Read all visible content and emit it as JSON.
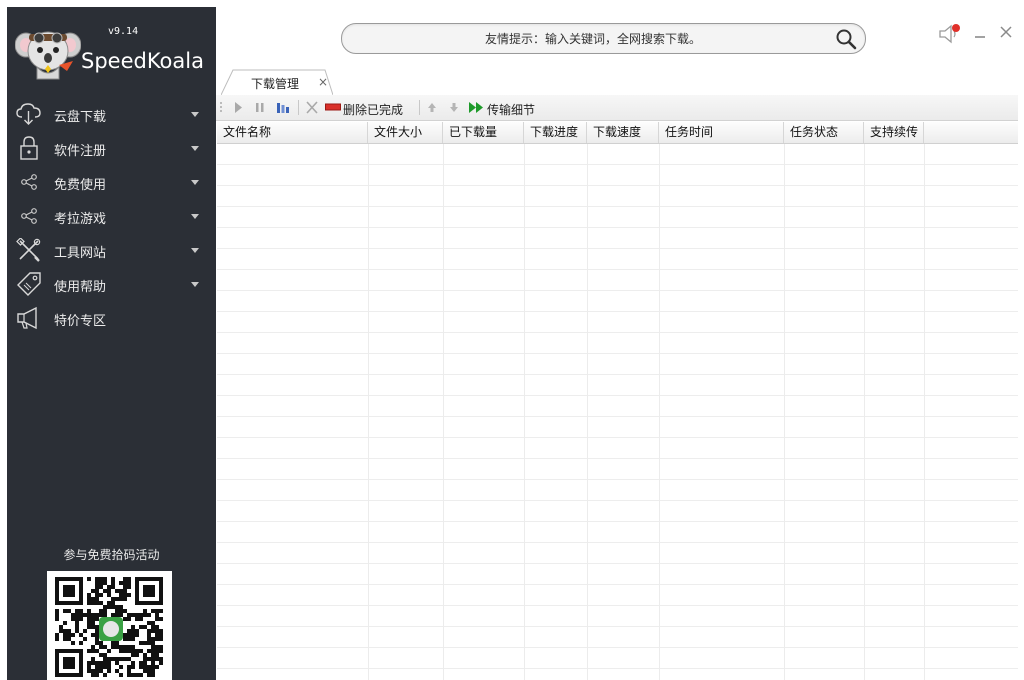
{
  "app": {
    "version": "v9.14",
    "name": "SpeedKoala"
  },
  "sidebar": {
    "items": [
      {
        "label": "云盘下载",
        "icon": "cloud-download-icon",
        "has_caret": true
      },
      {
        "label": "软件注册",
        "icon": "lock-icon",
        "has_caret": true
      },
      {
        "label": "免费使用",
        "icon": "share-icon",
        "has_caret": true
      },
      {
        "label": "考拉游戏",
        "icon": "share-icon",
        "has_caret": true
      },
      {
        "label": "工具网站",
        "icon": "tools-icon",
        "has_caret": true
      },
      {
        "label": "使用帮助",
        "icon": "tag-icon",
        "has_caret": true
      },
      {
        "label": "特价专区",
        "icon": "megaphone-icon",
        "has_caret": false
      }
    ],
    "promo_title": "参与免费拾码活动"
  },
  "search": {
    "placeholder": "友情提示：输入关键词，全网搜索下载。"
  },
  "tabs": [
    {
      "label": "下载管理",
      "close": "×"
    }
  ],
  "toolbar": {
    "delete_completed": "删除已完成",
    "transfer_details": "传输细节"
  },
  "table": {
    "columns": [
      "文件名称",
      "文件大小",
      "已下载量",
      "下载进度",
      "下载速度",
      "任务时间",
      "任务状态",
      "支持续传"
    ],
    "rows": []
  },
  "colors": {
    "sidebar_bg": "#2b2f36",
    "notification_dot": "#e0302a",
    "delete_red": "#d9302a",
    "play_green": "#1e9a2a"
  }
}
